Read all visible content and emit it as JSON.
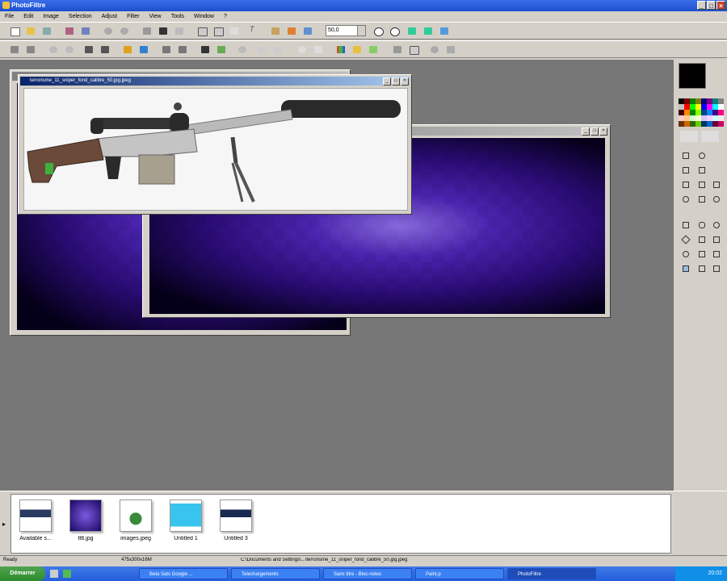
{
  "app": {
    "title": "PhotoFiltre"
  },
  "menu": [
    "File",
    "Edit",
    "Image",
    "Selection",
    "Adjust",
    "Filter",
    "View",
    "Tools",
    "Window",
    "?"
  ],
  "toolbar": {
    "zoom": "50,0"
  },
  "windows": {
    "gun_title": "terrorisme_11_sniper_fond_calibre_50.jpg.jpeg",
    "bg_title": "",
    "back_title": ""
  },
  "thumbnails": [
    {
      "label": "Available s..."
    },
    {
      "label": "tttt.jpg"
    },
    {
      "label": "images.jpeg"
    },
    {
      "label": "Untitled 1"
    },
    {
      "label": "Untitled 3"
    }
  ],
  "status": {
    "left": "Ready",
    "size": "475x300x16M",
    "path": "C:\\Documents and Settings\\...\\terrorisme_11_sniper_fond_calibre_50.jpg.jpeg"
  },
  "taskbar": {
    "start": "Démarrer",
    "tasks": [
      "Beta Sats Google ...",
      "Telechargements",
      "Sans titre - Bloc-notes",
      "Paint.p",
      "PhotoFiltre"
    ],
    "time": "20:02"
  },
  "colors": {
    "accent": "#0a246a",
    "taskbar": "#245edb",
    "workspace": "#777777"
  }
}
